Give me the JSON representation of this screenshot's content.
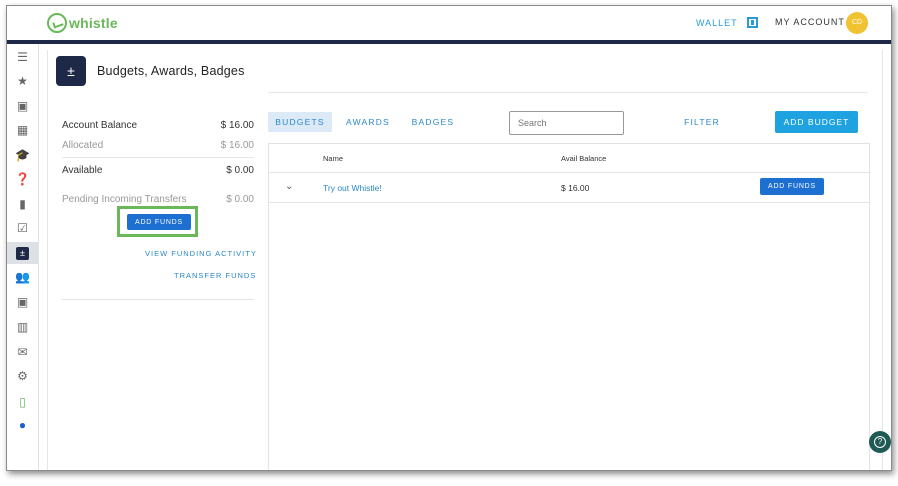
{
  "header": {
    "logo_text": "whistle",
    "wallet_label": "WALLET",
    "account_label": "MY ACCOUNT",
    "avatar_initials": "CD"
  },
  "sidebar": {
    "items": [
      {
        "icon": "list-icon",
        "glyph": "☰"
      },
      {
        "icon": "star-icon",
        "glyph": "★"
      },
      {
        "icon": "wallet-icon",
        "glyph": "▣"
      },
      {
        "icon": "grid-add-icon",
        "glyph": "▦"
      },
      {
        "icon": "graduation-cap-icon",
        "glyph": "🎓"
      },
      {
        "icon": "feedback-icon",
        "glyph": "❓"
      },
      {
        "icon": "book-icon",
        "glyph": "▮"
      },
      {
        "icon": "checkbox-icon",
        "glyph": "☑"
      },
      {
        "icon": "calculator-icon",
        "glyph": "±"
      },
      {
        "icon": "people-icon",
        "glyph": "👥"
      },
      {
        "icon": "wallet-add-icon",
        "glyph": "▣"
      },
      {
        "icon": "bar-chart-icon",
        "glyph": "▥"
      },
      {
        "icon": "mail-icon",
        "glyph": "✉"
      },
      {
        "icon": "gear-icon",
        "glyph": "⚙"
      },
      {
        "icon": "mobile-icon",
        "glyph": "▯"
      },
      {
        "icon": "user-circle-icon",
        "glyph": "●"
      }
    ]
  },
  "page": {
    "title": "Budgets, Awards, Badges",
    "icon_glyph": "±"
  },
  "balance": {
    "account_balance_label": "Account Balance",
    "account_balance_value": "$ 16.00",
    "allocated_label": "Allocated",
    "allocated_value": "$ 16.00",
    "available_label": "Available",
    "available_value": "$ 0.00",
    "pending_label": "Pending Incoming Transfers",
    "pending_value": "$ 0.00",
    "add_funds_label": "ADD FUNDS",
    "view_activity_label": "VIEW FUNDING ACTIVITY",
    "transfer_label": "TRANSFER FUNDS"
  },
  "tabs": [
    {
      "label": "BUDGETS",
      "active": true
    },
    {
      "label": "AWARDS",
      "active": false
    },
    {
      "label": "BADGES",
      "active": false
    }
  ],
  "search": {
    "placeholder": "Search"
  },
  "filter_label": "FILTER",
  "add_budget_label": "ADD BUDGET",
  "table": {
    "columns": [
      "Name",
      "Avail Balance"
    ],
    "rows": [
      {
        "name": "Try out Whistle!",
        "balance": "$ 16.00",
        "action": "ADD FUNDS"
      }
    ]
  },
  "colors": {
    "navy": "#1e2847",
    "brand_green": "#6ab85a",
    "primary_blue": "#1d6fd1",
    "link_blue": "#2a88c9"
  }
}
